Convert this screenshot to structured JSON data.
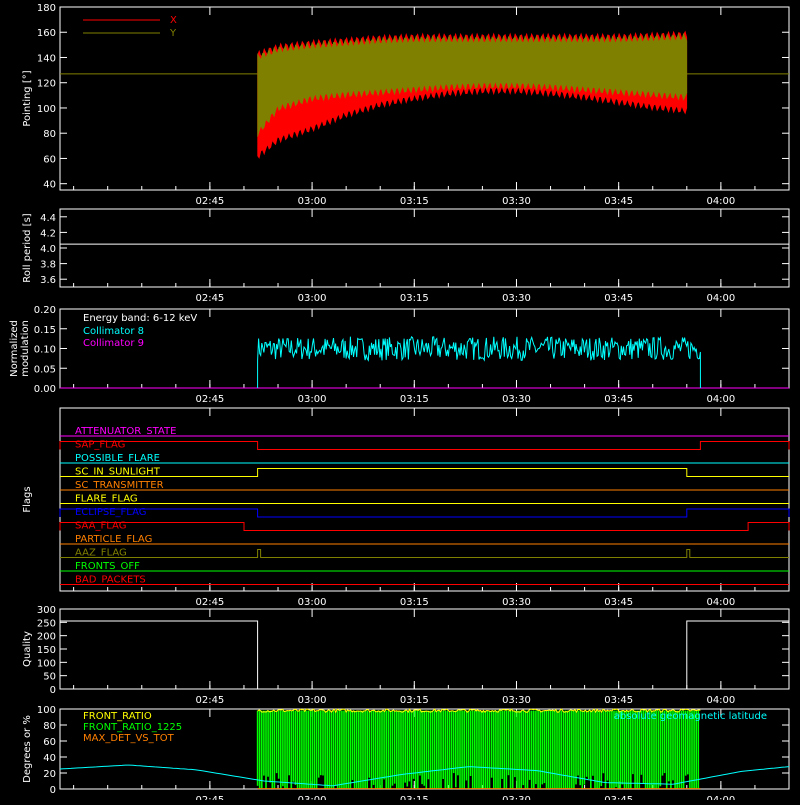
{
  "time_axis": {
    "range": [
      "02:23",
      "04:10"
    ],
    "ticks": [
      "02:45",
      "03:00",
      "03:15",
      "03:30",
      "03:45",
      "04:00"
    ]
  },
  "chart_data": [
    {
      "id": "pointing",
      "type": "line",
      "ylabel": "Pointing [°]",
      "ylim": [
        35,
        180
      ],
      "yticks": [
        40,
        60,
        80,
        100,
        120,
        140,
        160,
        180
      ],
      "legend": {
        "placement": "top-left",
        "entries": [
          {
            "name": "X",
            "color": "#ff0000"
          },
          {
            "name": "Y",
            "color": "#808000"
          }
        ]
      },
      "baseline": 127,
      "active": [
        "02:52",
        "03:55"
      ],
      "envelope_x": {
        "t": [
          "02:52",
          "02:55",
          "03:00",
          "03:05",
          "03:10",
          "03:15",
          "03:20",
          "03:25",
          "03:30",
          "03:35",
          "03:40",
          "03:45",
          "03:50",
          "03:55"
        ],
        "low": [
          62,
          75,
          84,
          95,
          103,
          108,
          112,
          114,
          114,
          112,
          109,
          105,
          101,
          98
        ],
        "high": [
          142,
          148,
          151,
          153,
          155,
          156,
          156,
          156,
          156,
          156,
          156,
          156,
          157,
          158
        ]
      },
      "envelope_y": {
        "t": [
          "02:52",
          "02:55",
          "03:00",
          "03:05",
          "03:10",
          "03:15",
          "03:20",
          "03:25",
          "03:30",
          "03:35",
          "03:40",
          "03:45",
          "03:50",
          "03:55"
        ],
        "low": [
          80,
          100,
          108,
          111,
          113,
          115,
          117,
          118,
          118,
          117,
          115,
          113,
          111,
          109
        ],
        "high": [
          140,
          146,
          149,
          151,
          153,
          154,
          154,
          154,
          154,
          154,
          154,
          154,
          155,
          156
        ]
      }
    },
    {
      "id": "roll-period",
      "type": "line",
      "ylabel": "Roll period [s]",
      "ylim": [
        3.5,
        4.5
      ],
      "yticks": [
        "3.6",
        "3.8",
        "4.0",
        "4.2",
        "4.4"
      ],
      "series": [
        {
          "color": "#ffffff",
          "values": [
            4.05
          ]
        }
      ]
    },
    {
      "id": "modulation",
      "type": "line",
      "ylabel": "Normalized modulation",
      "ylim": [
        0,
        0.2
      ],
      "yticks": [
        "0.00",
        "0.05",
        "0.10",
        "0.15",
        "0.20"
      ],
      "annotation": "Energy band: 6-12 keV",
      "legend": {
        "placement": "top-left",
        "entries": [
          {
            "name": "Collimator 8",
            "color": "#00ffff"
          },
          {
            "name": "Collimator 9",
            "color": "#ff00ff"
          }
        ]
      },
      "active": [
        "02:52",
        "03:57"
      ],
      "typical": 0.1,
      "spread": [
        0.07,
        0.13
      ]
    },
    {
      "id": "flags",
      "type": "line",
      "ylabel": "Flags",
      "flags": [
        {
          "name": "ATTENUATOR_STATE",
          "color": "#ff00ff",
          "raised": []
        },
        {
          "name": "SAP_FLAG",
          "color": "#ff0000",
          "raised": [
            [
              "02:23",
              "02:52"
            ],
            [
              "03:57",
              "04:10"
            ]
          ]
        },
        {
          "name": "POSSIBLE_FLARE",
          "color": "#00ffff",
          "raised": []
        },
        {
          "name": "SC_IN_SUNLIGHT",
          "color": "#ffff00",
          "raised": [
            [
              "02:52",
              "03:55"
            ]
          ]
        },
        {
          "name": "SC_TRANSMITTER",
          "color": "#ff8000",
          "raised": []
        },
        {
          "name": "FLARE_FLAG",
          "color": "#ffff00",
          "raised": []
        },
        {
          "name": "ECLIPSE_FLAG",
          "color": "#0000ff",
          "raised": [
            [
              "02:23",
              "02:52"
            ],
            [
              "03:55",
              "04:10"
            ]
          ]
        },
        {
          "name": "SAA_FLAG",
          "color": "#ff0000",
          "raised": [
            [
              "02:23",
              "02:50"
            ],
            [
              "04:04",
              "04:10"
            ]
          ]
        },
        {
          "name": "PARTICLE_FLAG",
          "color": "#ff8000",
          "raised": []
        },
        {
          "name": "AAZ_FLAG",
          "color": "#808000",
          "raised": [
            [
              "02:52",
              "02:52"
            ],
            [
              "03:55",
              "03:55"
            ]
          ]
        },
        {
          "name": "FRONTS_OFF",
          "color": "#00ff00",
          "raised": []
        },
        {
          "name": "BAD_PACKETS",
          "color": "#ff0000",
          "raised": []
        }
      ]
    },
    {
      "id": "quality",
      "type": "line",
      "ylabel": "Quality",
      "ylim": [
        0,
        300
      ],
      "yticks": [
        0,
        50,
        100,
        150,
        200,
        250,
        300
      ],
      "series": [
        {
          "color": "#ffffff",
          "t": [
            "02:23",
            "02:52",
            "02:52",
            "03:55",
            "03:55",
            "04:10"
          ],
          "values": [
            255,
            255,
            0,
            0,
            255,
            255
          ]
        }
      ]
    },
    {
      "id": "ratios",
      "type": "line",
      "ylabel": "Degrees or %",
      "ylim": [
        0,
        100
      ],
      "yticks": [
        0,
        20,
        40,
        60,
        80,
        100
      ],
      "legend": {
        "placement": "top-left",
        "entries": [
          {
            "name": "FRONT_RATIO",
            "color": "#ffff00"
          },
          {
            "name": "FRONT_RATIO_1225",
            "color": "#00ff00"
          },
          {
            "name": "MAX_DET_VS_TOT",
            "color": "#ff8000"
          }
        ]
      },
      "latitude_label": {
        "text": "absolute geomagnetic latitude",
        "color": "#00ffff",
        "placement": "top-right"
      },
      "active": [
        "02:52",
        "03:57"
      ],
      "latitude": {
        "t": [
          "02:23",
          "02:33",
          "02:43",
          "02:53",
          "03:03",
          "03:13",
          "03:23",
          "03:33",
          "03:43",
          "03:53",
          "04:03",
          "04:10"
        ],
        "values": [
          25,
          30,
          24,
          10,
          4,
          18,
          28,
          23,
          8,
          6,
          22,
          28
        ]
      }
    }
  ]
}
